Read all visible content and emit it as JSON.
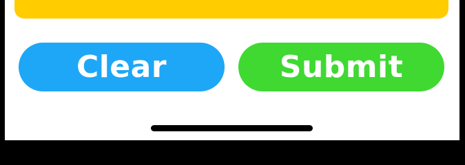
{
  "colors": {
    "frame": "#000000",
    "background": "#ffffff",
    "top_panel": "#FFCC00",
    "clear_button": "#1EA7F7",
    "submit_button": "#3FD932",
    "button_text": "#ffffff",
    "home_indicator": "#000000"
  },
  "actions": {
    "clear_label": "Clear",
    "submit_label": "Submit"
  }
}
